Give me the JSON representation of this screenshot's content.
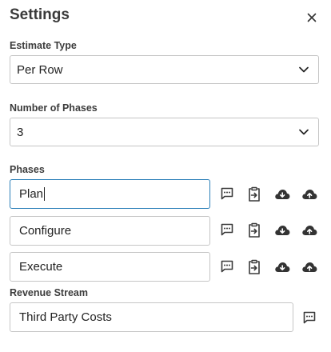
{
  "header": {
    "title": "Settings",
    "close_icon": "close-icon"
  },
  "estimate_type": {
    "label": "Estimate Type",
    "value": "Per Row"
  },
  "number_of_phases": {
    "label": "Number of Phases",
    "value": "3"
  },
  "phases": {
    "label": "Phases",
    "items": [
      {
        "value": "Plan",
        "focused": true
      },
      {
        "value": "Configure",
        "focused": false
      },
      {
        "value": "Execute",
        "focused": false
      }
    ],
    "row_icons": [
      "comment-icon",
      "clipboard-import-icon",
      "cloud-download-icon",
      "cloud-upload-icon"
    ]
  },
  "revenue_stream": {
    "label": "Revenue Stream",
    "value": "Third Party Costs"
  },
  "colors": {
    "focus_border": "#2a7fb8",
    "border": "#c5c5c5",
    "icon": "#3a3a3a"
  }
}
